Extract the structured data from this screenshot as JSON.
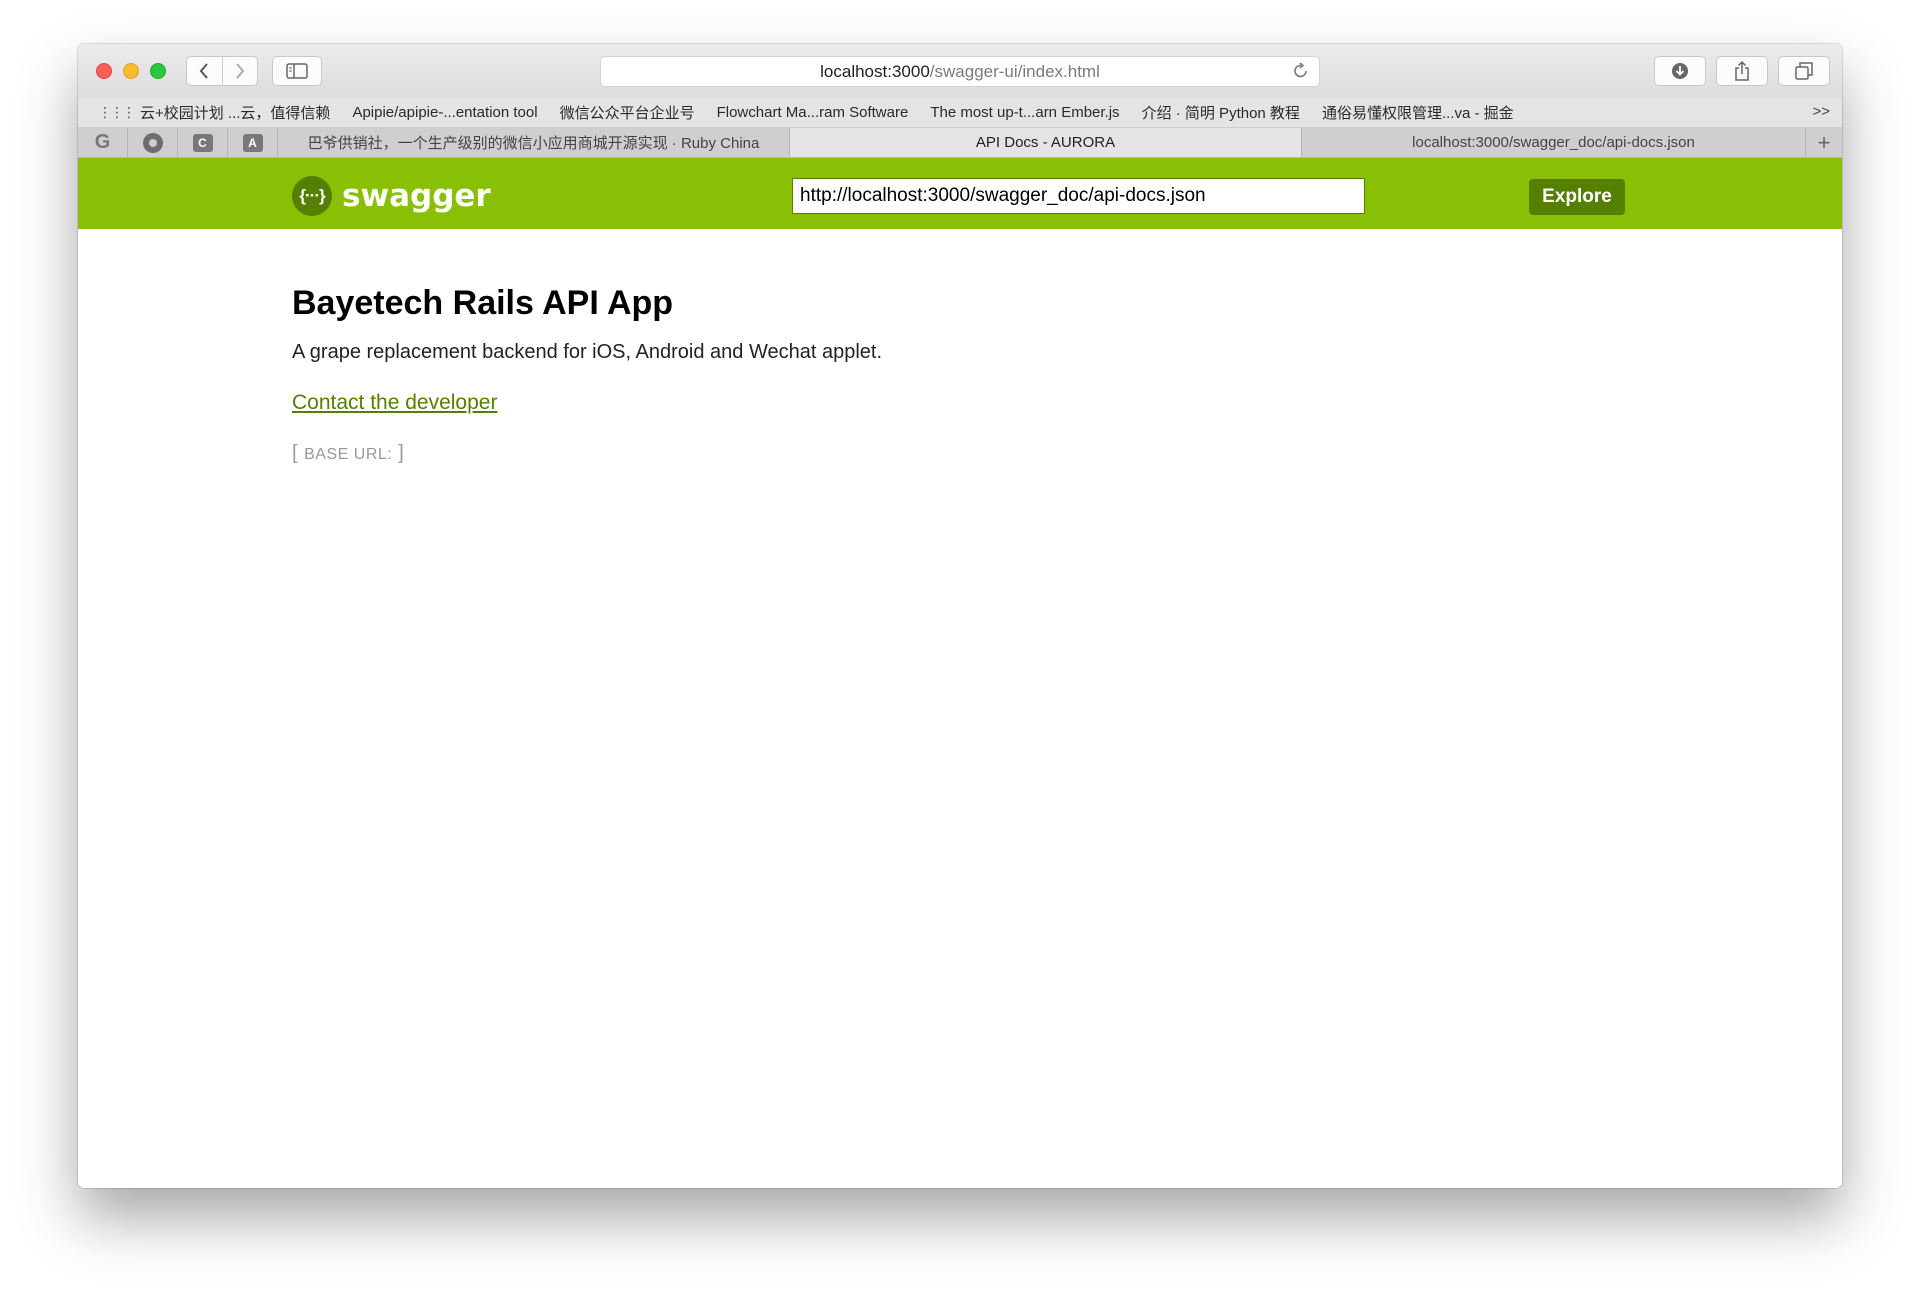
{
  "browser": {
    "address": {
      "host": "localhost:3000",
      "path": "/swagger-ui/index.html"
    },
    "bookmarks": [
      "云+校园计划 ...云，值得信赖",
      "Apipie/apipie-...entation tool",
      "微信公众平台企业号",
      "Flowchart Ma...ram Software",
      "The most up-t...arn Ember.js",
      "介绍 · 简明 Python 教程",
      "通俗易懂权限管理...va - 掘金"
    ],
    "bookmarks_more": ">>",
    "pinned_tabs": [
      {
        "icon": "google-icon",
        "glyph": "G"
      },
      {
        "icon": "github-icon",
        "glyph": ""
      },
      {
        "icon": "c-icon",
        "glyph": "C"
      },
      {
        "icon": "a-icon",
        "glyph": "A"
      }
    ],
    "tabs": [
      {
        "title": "巴爷供销社，一个生产级别的微信小应用商城开源实现 · Ruby China",
        "active": false
      },
      {
        "title": "API Docs - AURORA",
        "active": true
      },
      {
        "title": "localhost:3000/swagger_doc/api-docs.json",
        "active": false
      }
    ],
    "new_tab": "+"
  },
  "swagger": {
    "logo_text": "swagger",
    "logo_icon": "{···}",
    "url_value": "http://localhost:3000/swagger_doc/api-docs.json",
    "explore_label": "Explore",
    "brand_color": "#89bf04",
    "accent_color": "#547f00"
  },
  "info": {
    "title": "Bayetech Rails API App",
    "description": "A grape replacement backend for iOS, Android and Wechat applet.",
    "contact_label": "Contact the developer",
    "base_url_label": "BASE URL:",
    "base_url_value": ""
  }
}
